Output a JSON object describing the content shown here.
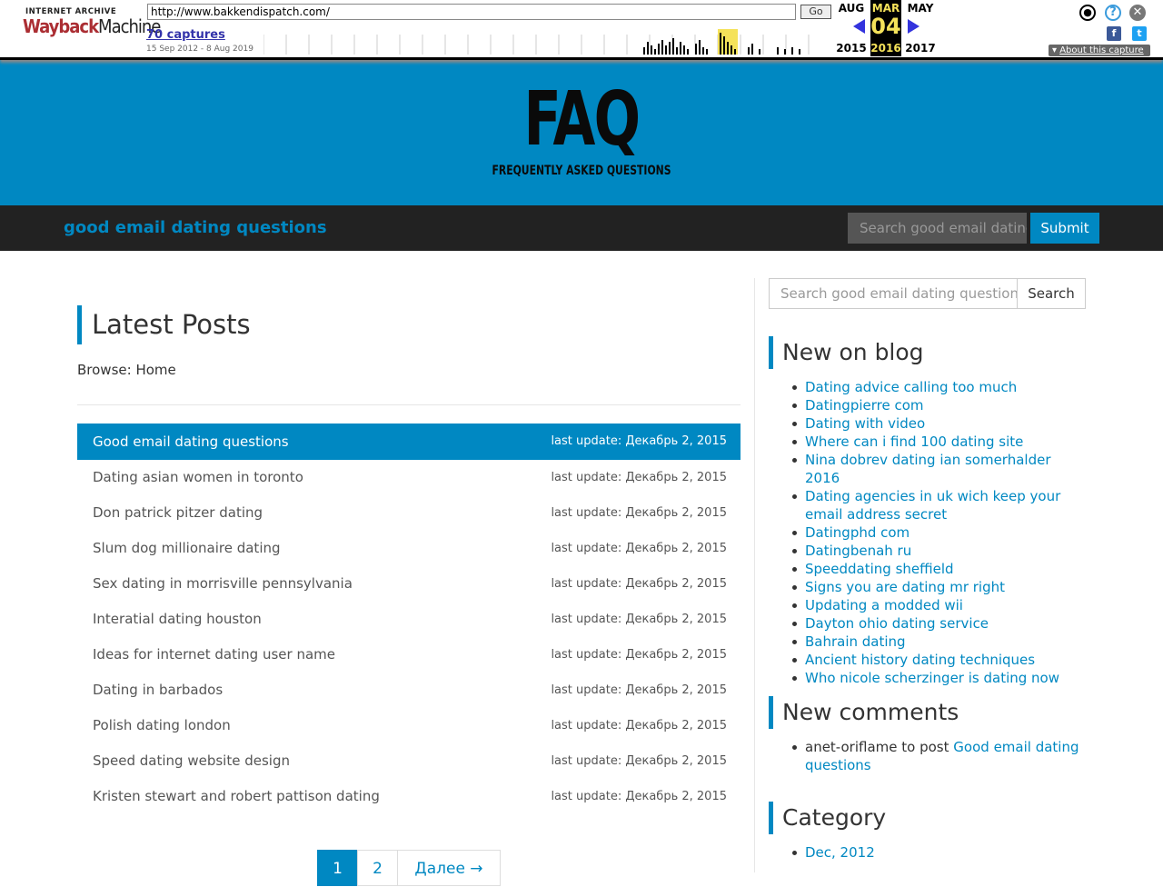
{
  "wayback": {
    "brand_top": "INTERNET ARCHIVE",
    "brand_left": "Wayback",
    "brand_right": "Machine",
    "url": "http://www.bakkendispatch.com/",
    "go_label": "Go",
    "captures": "70 captures",
    "range": "15 Sep 2012 - 8 Aug 2019",
    "prev_month": "AUG",
    "cur_month": "MAR",
    "next_month": "MAY",
    "cur_day": "04",
    "prev_year": "2015",
    "cur_year": "2016",
    "next_year": "2017",
    "about": "About this capture",
    "colors": {
      "brand_red": "#ab2e33",
      "link_blue": "#3333aa",
      "highlight": "#f5e25a"
    }
  },
  "header": {
    "logo_main": "FAQ",
    "logo_sub": "FREQUENTLY ASKED QUESTIONS",
    "site_title": "good email dating questions",
    "search_placeholder": "Search good email dating questions",
    "submit_label": "Submit",
    "colors": {
      "brand": "#0088c2",
      "nav_bg": "#222222"
    }
  },
  "main": {
    "heading": "Latest Posts",
    "browse": "Browse: Home",
    "posts": [
      {
        "title": "Good email dating questions",
        "date": "last update: Декабрь 2, 2015"
      },
      {
        "title": "Dating asian women in toronto",
        "date": "last update: Декабрь 2, 2015"
      },
      {
        "title": "Don patrick pitzer dating",
        "date": "last update: Декабрь 2, 2015"
      },
      {
        "title": "Slum dog millionaire dating",
        "date": "last update: Декабрь 2, 2015"
      },
      {
        "title": "Sex dating in morrisville pennsylvania",
        "date": "last update: Декабрь 2, 2015"
      },
      {
        "title": "Interatial dating houston",
        "date": "last update: Декабрь 2, 2015"
      },
      {
        "title": "Ideas for internet dating user name",
        "date": "last update: Декабрь 2, 2015"
      },
      {
        "title": "Dating in barbados",
        "date": "last update: Декабрь 2, 2015"
      },
      {
        "title": "Polish dating london",
        "date": "last update: Декабрь 2, 2015"
      },
      {
        "title": "Speed dating website design",
        "date": "last update: Декабрь 2, 2015"
      },
      {
        "title": "Kristen stewart and robert pattison dating",
        "date": "last update: Декабрь 2, 2015"
      }
    ],
    "pagination": {
      "page1": "1",
      "page2": "2",
      "next": "Далее →"
    }
  },
  "sidebar": {
    "search_placeholder": "Search good email dating questions",
    "search_button": "Search",
    "new_on_blog_heading": "New on blog",
    "new_on_blog": [
      "Dating advice calling too much",
      "Datingpierre com",
      "Dating with video",
      "Where can i find 100 dating site",
      "Nina dobrev dating ian somerhalder 2016",
      "Dating agencies in uk wich keep your email address secret",
      "Datingphd com",
      "Datingbenah ru",
      "Speeddating sheffield",
      "Signs you are dating mr right",
      "Updating a modded wii",
      "Dayton ohio dating service",
      "Bahrain dating",
      "Ancient history dating techniques",
      "Who nicole scherzinger is dating now"
    ],
    "new_comments_heading": "New comments",
    "comment": {
      "author": "anet-oriflame",
      "to_post": "to post",
      "post_title": "Good email dating questions"
    },
    "category_heading": "Category",
    "categories": [
      "Dec, 2012"
    ]
  }
}
